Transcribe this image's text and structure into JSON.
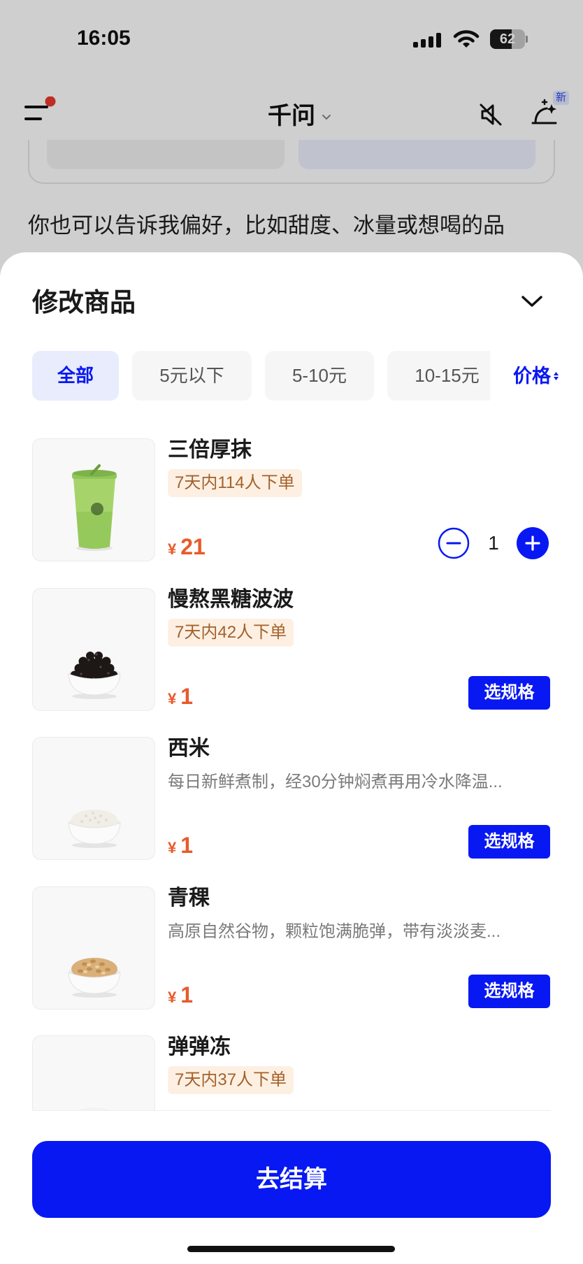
{
  "status_bar": {
    "time": "16:05",
    "battery": "62"
  },
  "header": {
    "title": "千问",
    "new_badge": "新"
  },
  "chat": {
    "hint_text": "你也可以告诉我偏好，比如甜度、冰量或想喝的品"
  },
  "sheet": {
    "title": "修改商品",
    "filters": [
      {
        "label": "全部",
        "active": true
      },
      {
        "label": "5元以下",
        "active": false
      },
      {
        "label": "5-10元",
        "active": false
      },
      {
        "label": "10-15元",
        "active": false
      }
    ],
    "sort_label": "价格",
    "currency": "¥",
    "products": [
      {
        "name": "三倍厚抹",
        "tag": "7天内114人下单",
        "price": "21",
        "quantity": "1",
        "image_icon": "matcha-drink-icon"
      },
      {
        "name": "慢熬黑糖波波",
        "tag": "7天内42人下单",
        "price": "1",
        "action_label": "选规格",
        "image_icon": "brown-sugar-boba-bowl-icon"
      },
      {
        "name": "西米",
        "description": "每日新鲜煮制，经30分钟焖煮再用冷水降温...",
        "price": "1",
        "action_label": "选规格",
        "image_icon": "sago-bowl-icon"
      },
      {
        "name": "青稞",
        "description": "高原自然谷物，颗粒饱满脆弹，带有淡淡麦...",
        "price": "1",
        "action_label": "选规格",
        "image_icon": "highland-barley-bowl-icon"
      },
      {
        "name": "弹弹冻",
        "tag": "7天内37人下单",
        "image_icon": "jelly-bowl-icon"
      }
    ],
    "checkout_label": "去结算"
  },
  "icons": {
    "menu": "menu-icon",
    "notification": "notification-dot-icon",
    "title_chevron": "chevron-down-icon",
    "mute": "mute-icon",
    "create": "sparkle-create-icon",
    "close_sheet": "chevron-down-icon",
    "sort": "sort-icon",
    "decrease": "minus-circle-icon",
    "increase": "plus-circle-icon",
    "signal": "cellular-signal-icon",
    "wifi": "wifi-icon",
    "battery": "battery-icon"
  },
  "colors": {
    "primary": "#0818f2",
    "price": "#e85a2c",
    "tag_bg": "#fdf0e3",
    "tag_text": "#a4612b",
    "notification_dot": "#e8392f",
    "active_filter_bg": "#e8ecfd"
  }
}
